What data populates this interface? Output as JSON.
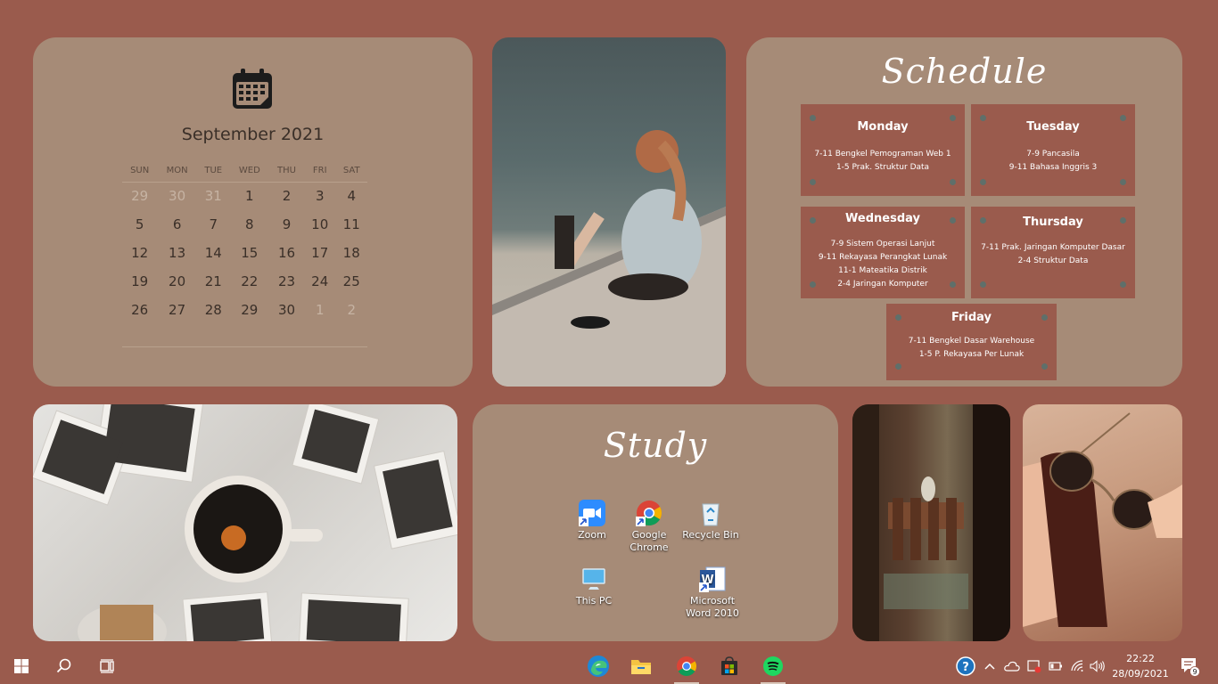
{
  "calendar": {
    "title": "September 2021",
    "weekdays": [
      "SUN",
      "MON",
      "TUE",
      "WED",
      "THU",
      "FRI",
      "SAT"
    ],
    "weeks": [
      [
        {
          "d": "29",
          "m": true
        },
        {
          "d": "30",
          "m": true
        },
        {
          "d": "31",
          "m": true
        },
        {
          "d": "1"
        },
        {
          "d": "2"
        },
        {
          "d": "3"
        },
        {
          "d": "4"
        }
      ],
      [
        {
          "d": "5"
        },
        {
          "d": "6"
        },
        {
          "d": "7"
        },
        {
          "d": "8"
        },
        {
          "d": "9"
        },
        {
          "d": "10"
        },
        {
          "d": "11"
        }
      ],
      [
        {
          "d": "12"
        },
        {
          "d": "13"
        },
        {
          "d": "14"
        },
        {
          "d": "15"
        },
        {
          "d": "16"
        },
        {
          "d": "17"
        },
        {
          "d": "18"
        }
      ],
      [
        {
          "d": "19"
        },
        {
          "d": "20"
        },
        {
          "d": "21"
        },
        {
          "d": "22"
        },
        {
          "d": "23"
        },
        {
          "d": "24"
        },
        {
          "d": "25"
        }
      ],
      [
        {
          "d": "26"
        },
        {
          "d": "27"
        },
        {
          "d": "28"
        },
        {
          "d": "29"
        },
        {
          "d": "30"
        },
        {
          "d": "1",
          "m": true
        },
        {
          "d": "2",
          "m": true
        }
      ]
    ]
  },
  "schedule": {
    "title": "Schedule",
    "days": [
      {
        "name": "Monday",
        "lines": [
          "7-11 Bengkel Pemograman Web 1",
          "1-5 Prak. Struktur Data"
        ]
      },
      {
        "name": "Tuesday",
        "lines": [
          "7-9 Pancasila",
          "9-11 Bahasa Inggris 3"
        ]
      },
      {
        "name": "Wednesday",
        "lines": [
          "7-9 Sistem Operasi Lanjut",
          "9-11 Rekayasa Perangkat Lunak",
          "11-1 Mateatika Distrik",
          "2-4 Jaringan Komputer"
        ]
      },
      {
        "name": "Thursday",
        "lines": [
          "7-11 Prak. Jaringan Komputer Dasar",
          "2-4 Struktur Data"
        ]
      },
      {
        "name": "Friday",
        "lines": [
          "7-11 Bengkel Dasar Warehouse",
          "1-5 P. Rekayasa Per Lunak"
        ]
      }
    ]
  },
  "study": {
    "title": "Study",
    "icons": {
      "zoom": "Zoom",
      "chrome_1": "Google",
      "chrome_2": "Chrome",
      "recycle": "Recycle Bin",
      "thispc": "This PC",
      "word_1": "Microsoft",
      "word_2": "Word 2010"
    }
  },
  "taskbar": {
    "time": "22:22",
    "date": "28/09/2021",
    "notification_count": "9",
    "pinned": [
      "edge-icon",
      "file-explorer-icon",
      "chrome-icon",
      "store-icon",
      "spotify-icon"
    ]
  },
  "colors": {
    "background": "#9a5b4d",
    "panel": "#a68b77",
    "card": "#9a5b4d"
  }
}
